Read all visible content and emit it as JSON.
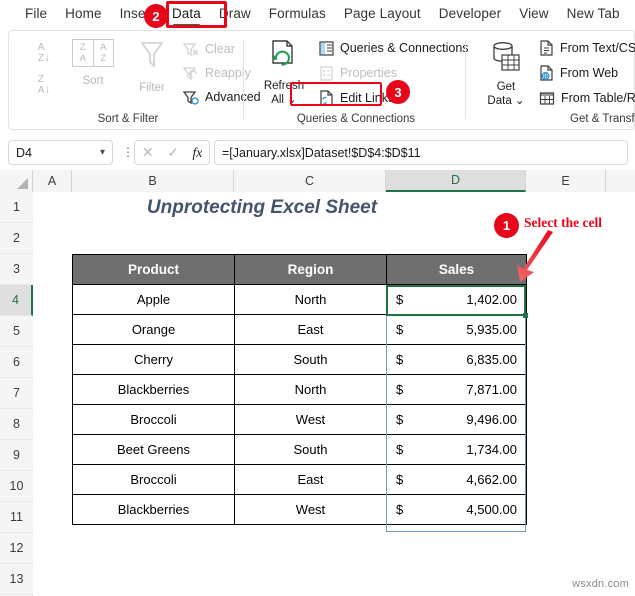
{
  "app": {
    "watermark": "wsxdn.com"
  },
  "tabs": [
    {
      "label": "File",
      "active": false
    },
    {
      "label": "Home",
      "active": false
    },
    {
      "label": "Insert",
      "active": false
    },
    {
      "label": "Data",
      "active": true
    },
    {
      "label": "Draw",
      "active": false
    },
    {
      "label": "Formulas",
      "active": false
    },
    {
      "label": "Page Layout",
      "active": false
    },
    {
      "label": "Developer",
      "active": false
    },
    {
      "label": "View",
      "active": false
    },
    {
      "label": "New Tab",
      "active": false
    }
  ],
  "ribbon": {
    "sort_filter": {
      "group_label": "Sort & Filter",
      "sort_az_icon": "sort-ascending-icon",
      "sort_za_icon": "sort-descending-icon",
      "sort_label": "Sort",
      "filter_label": "Filter",
      "clear_label": "Clear",
      "reapply_label": "Reapply",
      "advanced_label": "Advanced"
    },
    "queries_connections": {
      "group_label": "Queries & Connections",
      "refresh_line1": "Refresh",
      "refresh_line2": "All",
      "queries_label": "Queries & Connections",
      "properties_label": "Properties",
      "edit_links_label": "Edit Links"
    },
    "get_transform": {
      "group_label": "Get & Transfo",
      "get_data_line1": "Get",
      "get_data_line2": "Data",
      "from_text_csv_label": "From Text/CSV",
      "from_web_label": "From Web",
      "from_table_range_label": "From Table/Range"
    }
  },
  "formula_bar": {
    "name_box_value": "D4",
    "cancel_icon": "cancel-x-icon",
    "enter_icon": "enter-check-icon",
    "function_icon": "fx-icon",
    "formula_value": "=[January.xlsx]Dataset!$D$4:$D$11"
  },
  "grid": {
    "column_headers": [
      "A",
      "B",
      "C",
      "D",
      "E"
    ],
    "active_column": "D",
    "row_headers": [
      "1",
      "2",
      "3",
      "4",
      "5",
      "6",
      "7",
      "8",
      "9",
      "10",
      "11",
      "12",
      "13"
    ],
    "active_row": "4",
    "sheet_title": "Unprotecting Excel Sheet",
    "active_cell": "D4"
  },
  "table": {
    "headers": [
      "Product",
      "Region",
      "Sales"
    ],
    "rows": [
      {
        "product": "Apple",
        "region": "North",
        "currency": "$",
        "sales": "1,402.00"
      },
      {
        "product": "Orange",
        "region": "East",
        "currency": "$",
        "sales": "5,935.00"
      },
      {
        "product": "Cherry",
        "region": "South",
        "currency": "$",
        "sales": "6,835.00"
      },
      {
        "product": "Blackberries",
        "region": "North",
        "currency": "$",
        "sales": "7,871.00"
      },
      {
        "product": "Broccoli",
        "region": "West",
        "currency": "$",
        "sales": "9,496.00"
      },
      {
        "product": "Beet Greens",
        "region": "South",
        "currency": "$",
        "sales": "1,734.00"
      },
      {
        "product": "Broccoli",
        "region": "East",
        "currency": "$",
        "sales": "4,662.00"
      },
      {
        "product": "Blackberries",
        "region": "West",
        "currency": "$",
        "sales": "4,500.00"
      }
    ]
  },
  "annotations": {
    "step1_number": "1",
    "step1_text": "Select the cell",
    "step2_number": "2",
    "step3_number": "3"
  },
  "colors": {
    "accent_green": "#217346",
    "annotation_red": "#e8061a",
    "table_header_gray": "#706f6f",
    "title_blue": "#44546a"
  }
}
